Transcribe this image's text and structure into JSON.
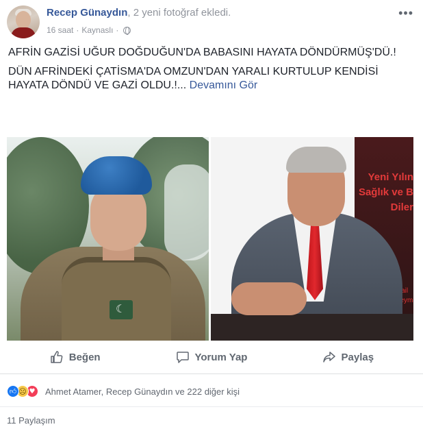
{
  "post": {
    "author_name": "Recep Günaydın",
    "author_action": ", 2 yeni fotoğraf ekledi.",
    "time": "16 saat",
    "separator": "·",
    "source": "Kaynaslı",
    "separator2": "·",
    "privacy_icon": "globe-icon",
    "more_icon": "more-options-icon",
    "more_glyph": "•••"
  },
  "text": {
    "para1": "AFRİN GAZİSİ UĞUR DOĞDUĞUN'DA BABASINI HAYATA DÖNDÜRMÜŞ'DÜ.!",
    "para2": "DÜN AFRİNDEKİ ÇATİSMA'DA OMZUN'DAN YARALI KURTULUP KENDİSİ HAYATA DÖNDÜ VE GAZİ OLDU.!...",
    "see_more": "Devamını Gör"
  },
  "photos": {
    "right_banner_text": [
      "Yeni Yılın",
      "Sağlık ve B",
      "Diler"
    ],
    "right_banner_small": [
      "İsmail",
      "Süleyman"
    ]
  },
  "actions": {
    "like_label": "Beğen",
    "comment_label": "Yorum Yap",
    "share_label": "Paylaş",
    "like_icon": "thumbs-up-icon",
    "comment_icon": "comment-icon",
    "share_icon": "share-arrow-icon"
  },
  "reactions": {
    "icons": [
      "like-reaction-icon",
      "sad-reaction-icon",
      "love-reaction-icon"
    ],
    "text": "Ahmet Atamer, Recep Günaydın ve 222 diğer kişi"
  },
  "shares": {
    "text": "11 Paylaşım"
  },
  "colors": {
    "link": "#365899",
    "meta": "#90949c",
    "action": "#606770",
    "like_blue": "#1877f2",
    "love_red": "#f33e58",
    "sad_yellow": "#f7c94b"
  }
}
